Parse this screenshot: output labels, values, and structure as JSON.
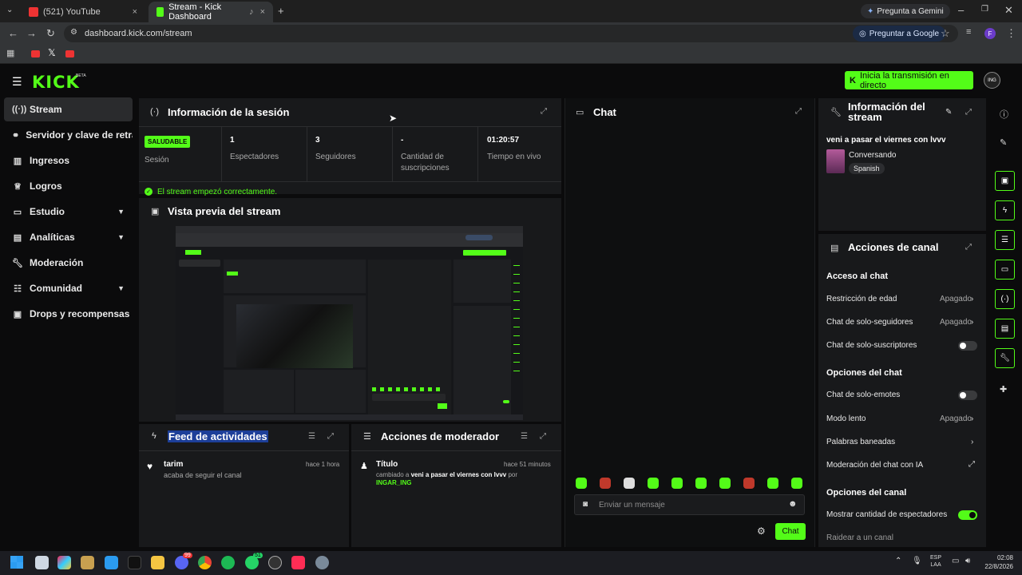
{
  "browser": {
    "tabs": [
      {
        "title": "(521) YouTube",
        "close": "×"
      },
      {
        "title": "Stream - Kick Dashboard",
        "close": "×"
      }
    ],
    "new_tab": "+",
    "gemini_button": "Pregunta a Gemini",
    "url": "dashboard.kick.com/stream",
    "google_button": "Preguntar a Google",
    "profile_initial": "F"
  },
  "header": {
    "logo": "KICK",
    "logo_badge": "BETA",
    "go_live_button": "Inicia la transmisión en directo",
    "avatar_text": "ING"
  },
  "sidebar": {
    "items": [
      {
        "label": "Stream",
        "icon": "broadcast-icon"
      },
      {
        "label": "Servidor y clave de retransmisión",
        "icon": "link-icon"
      },
      {
        "label": "Ingresos",
        "icon": "chart-icon"
      },
      {
        "label": "Logros",
        "icon": "trophy-icon"
      },
      {
        "label": "Estudio",
        "icon": "studio-icon"
      },
      {
        "label": "Analíticas",
        "icon": "analytics-icon"
      },
      {
        "label": "Moderación",
        "icon": "wrench-icon"
      },
      {
        "label": "Comunidad",
        "icon": "community-icon"
      },
      {
        "label": "Drops y recompensas",
        "icon": "gift-icon"
      }
    ]
  },
  "session": {
    "title": "Información de la sesión",
    "badge": "SALUDABLE",
    "session_label": "Sesión",
    "stats": [
      {
        "value": "1",
        "label": "Espectadores"
      },
      {
        "value": "3",
        "label": "Seguidores"
      },
      {
        "value": "-",
        "label": "Cantidad de suscripciones"
      },
      {
        "value": "01:20:57",
        "label": "Tiempo en vivo"
      }
    ],
    "status_message": "El stream empezó correctamente."
  },
  "preview": {
    "title": "Vista previa del stream"
  },
  "feed": {
    "title": "Feed de actividades",
    "items": [
      {
        "user": "tarim",
        "text": "acaba de seguir el canal",
        "time": "hace 1 hora"
      }
    ]
  },
  "mod_actions": {
    "title": "Acciones de moderador",
    "items": [
      {
        "title": "Título",
        "time": "hace 51 minutos",
        "prefix": "cambiado a",
        "value": "veni a pasar el viernes con lvvv",
        "by": "por",
        "user": "INGAR_ING"
      }
    ]
  },
  "chat": {
    "title": "Chat",
    "placeholder": "Enviar un mensaje",
    "send_button": "Chat"
  },
  "stream_info": {
    "title": "Información del stream",
    "stream_title": "veni a pasar el viernes con lvvv",
    "category": "Conversando",
    "tag": "Spanish"
  },
  "channel_actions": {
    "title": "Acciones de canal",
    "chat_access": "Acceso al chat",
    "age_restriction": "Restricción de edad",
    "age_restriction_value": "Apagado",
    "followers_only": "Chat de solo-seguidores",
    "followers_only_value": "Apagado",
    "subs_only": "Chat de solo-suscriptores",
    "chat_options": "Opciones del chat",
    "emotes_only": "Chat de solo-emotes",
    "slow_mode": "Modo lento",
    "slow_mode_value": "Apagado",
    "banned_words": "Palabras baneadas",
    "ai_moderation": "Moderación del chat con IA",
    "channel_options": "Opciones del canal",
    "show_viewers": "Mostrar cantidad de espectadores",
    "raid": "Raidear a un canal"
  },
  "taskbar": {
    "lang_top": "ESP",
    "lang_bottom": "LAA",
    "time": "02:08",
    "date": "22/8/2026",
    "badge_discord": "99",
    "badge_whatsapp": "51"
  },
  "colors": {
    "accent": "#53fc18",
    "bg": "#0b0b0c",
    "panel": "#18191b"
  }
}
